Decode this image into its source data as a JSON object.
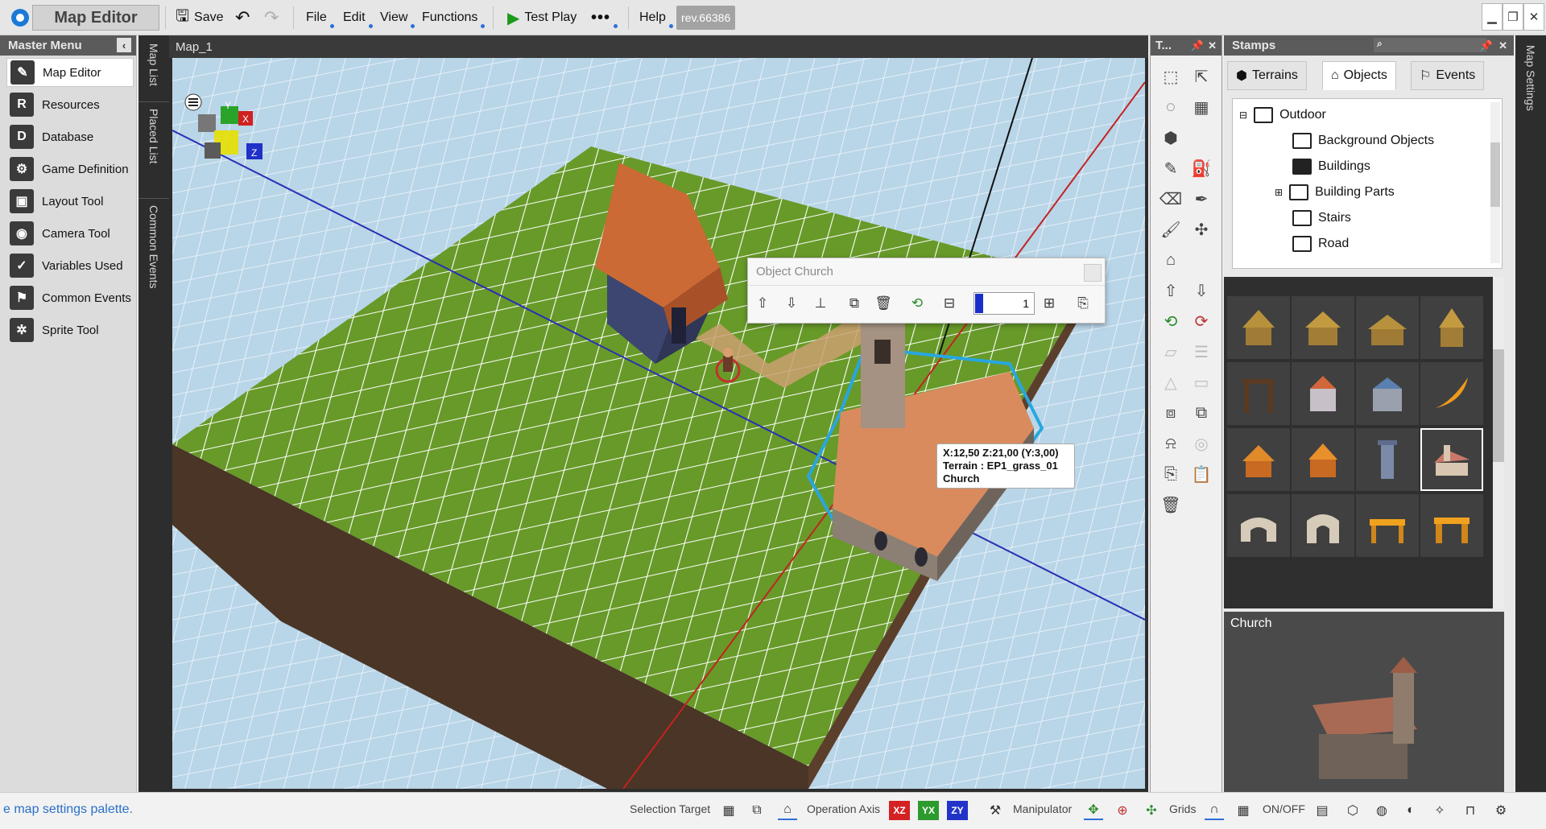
{
  "titlebar": {
    "app_title": "Map Editor",
    "save_label": "Save",
    "menus": [
      "File",
      "Edit",
      "View",
      "Functions"
    ],
    "test_play_label": "Test Play",
    "help_label": "Help",
    "revision": "rev.66386"
  },
  "master_menu": {
    "title": "Master Menu",
    "items": [
      {
        "label": "Map Editor",
        "icon": "map-editor-icon"
      },
      {
        "label": "Resources",
        "icon": "resources-icon"
      },
      {
        "label": "Database",
        "icon": "database-icon"
      },
      {
        "label": "Game Definition",
        "icon": "game-definition-icon"
      },
      {
        "label": "Layout Tool",
        "icon": "layout-tool-icon"
      },
      {
        "label": "Camera Tool",
        "icon": "camera-tool-icon"
      },
      {
        "label": "Variables Used",
        "icon": "variables-icon"
      },
      {
        "label": "Common Events",
        "icon": "common-events-icon"
      },
      {
        "label": "Sprite Tool",
        "icon": "sprite-tool-icon"
      }
    ]
  },
  "vertical_tabs": [
    "Map List",
    "Placed List",
    "Common Events"
  ],
  "viewport": {
    "map_name": "Map_1",
    "gizmo": {
      "x": "X",
      "y": "Y",
      "z": "Z"
    },
    "object_dialog": {
      "title": "Object Church",
      "layer_value": "1"
    },
    "tooltip": {
      "line1": "X:12,50 Z:21,00 (Y:3,00)",
      "line2": "Terrain : EP1_grass_01",
      "line3": "Church"
    }
  },
  "tools_panel": {
    "title": "T..."
  },
  "stamps": {
    "title": "Stamps",
    "tabs": [
      "Terrains",
      "Objects",
      "Events"
    ],
    "active_tab": "Objects",
    "tree": [
      {
        "label": "Outdoor",
        "level": 0,
        "expanded": true
      },
      {
        "label": "Background Objects",
        "level": 1
      },
      {
        "label": "Buildings",
        "level": 1,
        "selected": true
      },
      {
        "label": "Building Parts",
        "level": 1,
        "has_children": true
      },
      {
        "label": "Stairs",
        "level": 1
      },
      {
        "label": "Road",
        "level": 1
      }
    ],
    "preview_title": "Church"
  },
  "right_strip": {
    "label": "Map Settings"
  },
  "statusbar": {
    "hint": "e map settings palette.",
    "selection_target": "Selection Target",
    "operation_axis": "Operation Axis",
    "axes": [
      "XZ",
      "YX",
      "ZY"
    ],
    "manipulator": "Manipulator",
    "grids": "Grids",
    "on_off": "ON/OFF"
  },
  "colors": {
    "grass": "#6a9b2a",
    "water": "#b7d3e6",
    "axis_x": "#d21f1f",
    "axis_y": "#2b9a2b",
    "axis_z": "#2234c8",
    "selection_outline": "#27a7e0"
  }
}
